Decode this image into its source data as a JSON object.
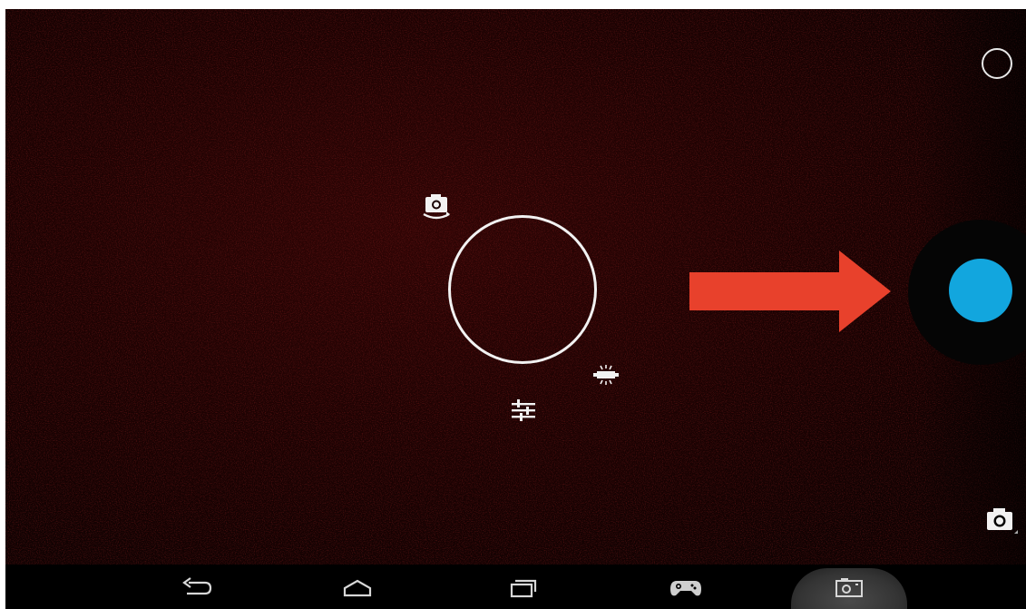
{
  "app": {
    "name": "Camera"
  },
  "viewfinder": {
    "pie_controls": [
      {
        "name": "switch-camera",
        "icon": "camera-switch-icon"
      },
      {
        "name": "flash",
        "icon": "flash-icon"
      },
      {
        "name": "settings",
        "icon": "sliders-icon"
      }
    ]
  },
  "side_controls": {
    "mode_indicator_icon": "circle-outline-icon",
    "shutter_icon": "shutter-button-icon",
    "camera_mode_icon": "camera-icon"
  },
  "annotation": {
    "arrow_icon": "red-arrow-icon",
    "arrow_color": "#e8412c"
  },
  "colors": {
    "shutter": "#12a6de",
    "background": "#000000",
    "viewfinder_tint": "#3a0404"
  },
  "navbar": {
    "buttons": [
      {
        "name": "back",
        "icon": "back-icon"
      },
      {
        "name": "home",
        "icon": "home-icon"
      },
      {
        "name": "recent-apps",
        "icon": "recents-icon"
      },
      {
        "name": "games",
        "icon": "gamepad-icon"
      },
      {
        "name": "screenshot",
        "icon": "screenshot-icon",
        "active": true
      }
    ]
  }
}
